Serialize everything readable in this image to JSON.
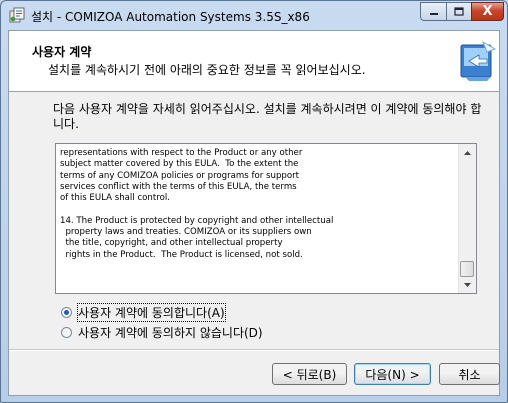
{
  "window": {
    "title": "설치 - COMIZOA Automation Systems 3.5S_x86",
    "close_glyph": "X"
  },
  "header": {
    "title": "사용자 계약",
    "subtitle": "설치를 계속하시기 전에 아래의 중요한 정보를 꼭 읽어보십시오."
  },
  "intro": "다음 사용자 계약을 자세히 읽어주십시오. 설치를 계속하시려면 이 계약에 동의해야 합니다.",
  "eula_text": "representations with respect to the Product or any other\nsubject matter covered by this EULA.  To the extent the\nterms of any COMIZOA policies or programs for support\nservices conflict with the terms of this EULA, the terms\nof this EULA shall control.\n\n14. The Product is protected by copyright and other intellectual\n  property laws and treaties. COMIZOA or its suppliers own\n  the title, copyright, and other intellectual property\n  rights in the Product.  The Product is licensed, not sold.",
  "options": {
    "accept_label": "사용자 계약에 동의합니다(A)",
    "accept_checked": true,
    "decline_label": "사용자 계약에 동의하지 않습니다(D)",
    "decline_checked": false
  },
  "buttons": {
    "back": "< 뒤로(B)",
    "next": "다음(N) >",
    "cancel": "취소"
  },
  "colors": {
    "title_bar": "#c9dbf0",
    "close_button": "#c8452d",
    "radio_dot": "#1e5fb4",
    "default_button_border": "#3c7fb1"
  }
}
